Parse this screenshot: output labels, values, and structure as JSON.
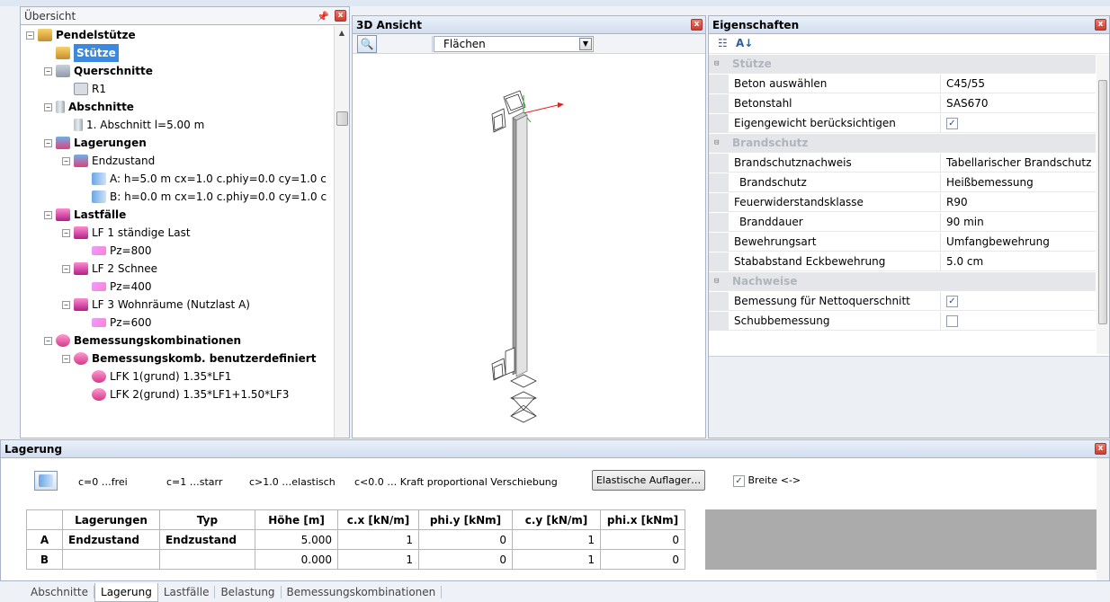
{
  "overview": {
    "title": "Übersicht",
    "tree": [
      {
        "label": "Pendelstütze",
        "bold": true,
        "depth": 0,
        "expander": "−",
        "icon": "person"
      },
      {
        "label": "Stütze",
        "selected": true,
        "depth": 1,
        "icon": "person"
      },
      {
        "label": "Querschnitte",
        "bold": true,
        "depth": 1,
        "expander": "−",
        "icon": "folder"
      },
      {
        "label": "R1",
        "depth": 2,
        "icon": "sq"
      },
      {
        "label": "Abschnitte",
        "bold": true,
        "depth": 1,
        "expander": "−",
        "icon": "bar"
      },
      {
        "label": "1. Abschnitt  l=5.00 m",
        "depth": 2,
        "icon": "bar"
      },
      {
        "label": "Lagerungen",
        "bold": true,
        "depth": 1,
        "expander": "−",
        "icon": "lager"
      },
      {
        "label": "Endzustand",
        "depth": 2,
        "expander": "−",
        "icon": "lager"
      },
      {
        "label": "A: h=5.0 m  cx=1.0 c.phiy=0.0 cy=1.0 c",
        "depth": 3,
        "icon": "sup"
      },
      {
        "label": "B: h=0.0 m  cx=1.0 c.phiy=0.0 cy=1.0 c",
        "depth": 3,
        "icon": "sup"
      },
      {
        "label": "Lastfälle",
        "bold": true,
        "depth": 1,
        "expander": "−",
        "icon": "load"
      },
      {
        "label": "LF 1 ständige Last",
        "depth": 2,
        "expander": "−",
        "icon": "load"
      },
      {
        "label": "Pz=800",
        "depth": 3,
        "icon": "arrow"
      },
      {
        "label": "LF 2 Schnee",
        "depth": 2,
        "expander": "−",
        "icon": "load"
      },
      {
        "label": "Pz=400",
        "depth": 3,
        "icon": "arrow"
      },
      {
        "label": "LF 3 Wohnräume (Nutzlast A)",
        "depth": 2,
        "expander": "−",
        "icon": "load"
      },
      {
        "label": "Pz=600",
        "depth": 3,
        "icon": "arrow"
      },
      {
        "label": "Bemessungskombinationen",
        "bold": true,
        "depth": 1,
        "expander": "−",
        "icon": "comb"
      },
      {
        "label": "Bemessungskomb. benutzerdefiniert",
        "bold": true,
        "depth": 2,
        "expander": "−",
        "icon": "comb"
      },
      {
        "label": "LFK 1(grund)  1.35*LF1",
        "depth": 3,
        "icon": "comb"
      },
      {
        "label": "LFK 2(grund)  1.35*LF1+1.50*LF3",
        "depth": 3,
        "icon": "comb"
      }
    ]
  },
  "view3d": {
    "title": "3D Ansicht",
    "display_mode": "Flächen"
  },
  "properties": {
    "title": "Eigenschaften",
    "rows": [
      {
        "type": "cat",
        "name": "Stütze"
      },
      {
        "name": "Beton auswählen",
        "value": "C45/55"
      },
      {
        "name": "Betonstahl",
        "value": "SAS670"
      },
      {
        "name": "Eigengewicht berücksichtigen",
        "check": true
      },
      {
        "type": "cat",
        "name": "Brandschutz"
      },
      {
        "name": "Brandschutznachweis",
        "value": "Tabellarischer Brandschutz"
      },
      {
        "name": "Brandschutz",
        "value": "Heißbemessung",
        "indent": true
      },
      {
        "name": "Feuerwiderstandsklasse",
        "value": "R90"
      },
      {
        "name": "Branddauer",
        "value": "90 min",
        "indent": true
      },
      {
        "name": "Bewehrungsart",
        "value": "Umfangbewehrung"
      },
      {
        "name": "Stababstand Eckbewehrung",
        "value": "5.0 cm"
      },
      {
        "type": "cat",
        "name": "Nachweise"
      },
      {
        "name": "Bemessung für Nettoquerschnitt",
        "check": true
      },
      {
        "name": "Schubbemessung",
        "check": false
      }
    ]
  },
  "lagerung": {
    "title": "Lagerung",
    "legend": [
      "c=0 …frei",
      "c=1 …starr",
      "c>1.0 …elastisch",
      "c<0.0 … Kraft proportional Verschiebung"
    ],
    "elastic_button": "Elastische Auflager…",
    "breite_label": "Breite <->",
    "breite_checked": true,
    "columns": [
      "Lagerungen",
      "Typ",
      "Höhe [m]",
      "c.x [kN/m]",
      "phi.y [kNm]",
      "c.y [kN/m]",
      "phi.x [kNm]"
    ],
    "rows": [
      {
        "id": "A",
        "cells": [
          "Endzustand",
          "Endzustand",
          "5.000",
          "1",
          "0",
          "1",
          "0"
        ]
      },
      {
        "id": "B",
        "cells": [
          "",
          "",
          "0.000",
          "1",
          "0",
          "1",
          "0"
        ]
      }
    ]
  },
  "tabs": [
    "Abschnitte",
    "Lagerung",
    "Lastfälle",
    "Belastung",
    "Bemessungskombinationen"
  ],
  "active_tab": "Lagerung",
  "colors": {
    "selection": "#3b88e0",
    "titlebar": "#d3deee",
    "grid_grey": "#ababab"
  }
}
